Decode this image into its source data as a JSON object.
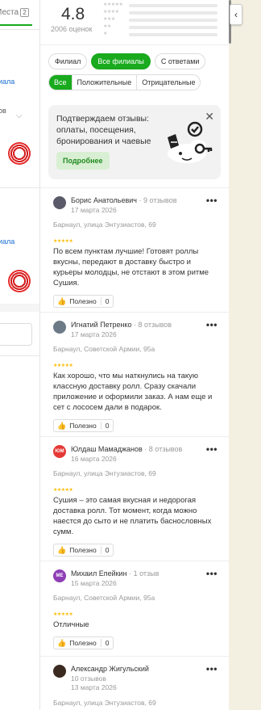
{
  "left_panel": {
    "tab_label": "Места",
    "tab_badge": "2",
    "link1": "иала",
    "text1": "ов",
    "link2": "иала"
  },
  "rating": {
    "value": "4.8",
    "count_label": "2006 оценок",
    "histogram_rows": [
      "★★★★★",
      "★★★★",
      "★★★",
      "★★",
      "★"
    ]
  },
  "filters": {
    "branch": [
      {
        "label": "Филиал",
        "active": false
      },
      {
        "label": "Все филиалы",
        "active": true
      },
      {
        "label": "С ответами",
        "active": false
      }
    ],
    "sentiment": [
      {
        "label": "Все",
        "active": true
      },
      {
        "label": "Положительные",
        "active": false
      },
      {
        "label": "Отрицательные",
        "active": false
      }
    ]
  },
  "promo": {
    "text": "Подтверждаем отзывы: оплаты, посещения, бронирования и чаевые",
    "button": "Подробнее"
  },
  "reviews": [
    {
      "name": "Борис Анатольевич",
      "count": "· 9 отзывов",
      "date": "17 марта 2026",
      "branch": "Барнаул, улица Энтузиастов, 69",
      "stars": "★★★★★",
      "text": "По всем пунктам лучшие! Готовят роллы вкусны, передают в доставку быстро и курьеры молодцы, не отстают в этом ритме Сушия.",
      "useful_label": "Полезно",
      "useful_count": "0",
      "avatar_color": "#5a5a6a",
      "avatar_text": ""
    },
    {
      "name": "Игнатий Петренко",
      "count": "· 8 отзывов",
      "date": "17 марта 2026",
      "branch": "Барнаул, Советской Армии, 95а",
      "stars": "★★★★★",
      "text": "Как хорошо, что мы наткнулись на такую классную доставку ролл. Сразу скачали приложение и оформили заказ. А нам еще и сет с лососем дали в подарок.",
      "useful_label": "Полезно",
      "useful_count": "0",
      "avatar_color": "#6b7a86",
      "avatar_text": ""
    },
    {
      "name": "Юлдаш Мамаджанов",
      "count": "· 8 отзывов",
      "date": "16 марта 2026",
      "branch": "Барнаул, улица Энтузиастов, 69",
      "stars": "★★★★★",
      "text": "Сушия – это самая вкусная и недорогая доставка ролл. Тот момент, когда можно наестся до сыто и не платить баснословных сумм.",
      "useful_label": "Полезно",
      "useful_count": "0",
      "avatar_color": "#e53935",
      "avatar_text": "ЮМ"
    },
    {
      "name": "Михаил Епейкин",
      "count": "· 1 отзыв",
      "date": "15 марта 2026",
      "branch": "Барнаул, Советской Армии, 95а",
      "stars": "★★★★★",
      "text": "Отличные",
      "useful_label": "Полезно",
      "useful_count": "0",
      "avatar_color": "#8e3fb5",
      "avatar_text": "МЕ"
    },
    {
      "name": "Александр Жигульский",
      "count": "",
      "subcount": "10 отзывов",
      "date": "13 марта 2026",
      "branch": "Барнаул, улица Энтузиастов, 69",
      "stars": "",
      "text": "",
      "useful_label": "",
      "useful_count": "",
      "avatar_color": "#3a2a20",
      "avatar_text": ""
    }
  ],
  "colors": {
    "accent": "#19aa1e",
    "star": "#fbbc05",
    "link": "#1a6fd1"
  }
}
